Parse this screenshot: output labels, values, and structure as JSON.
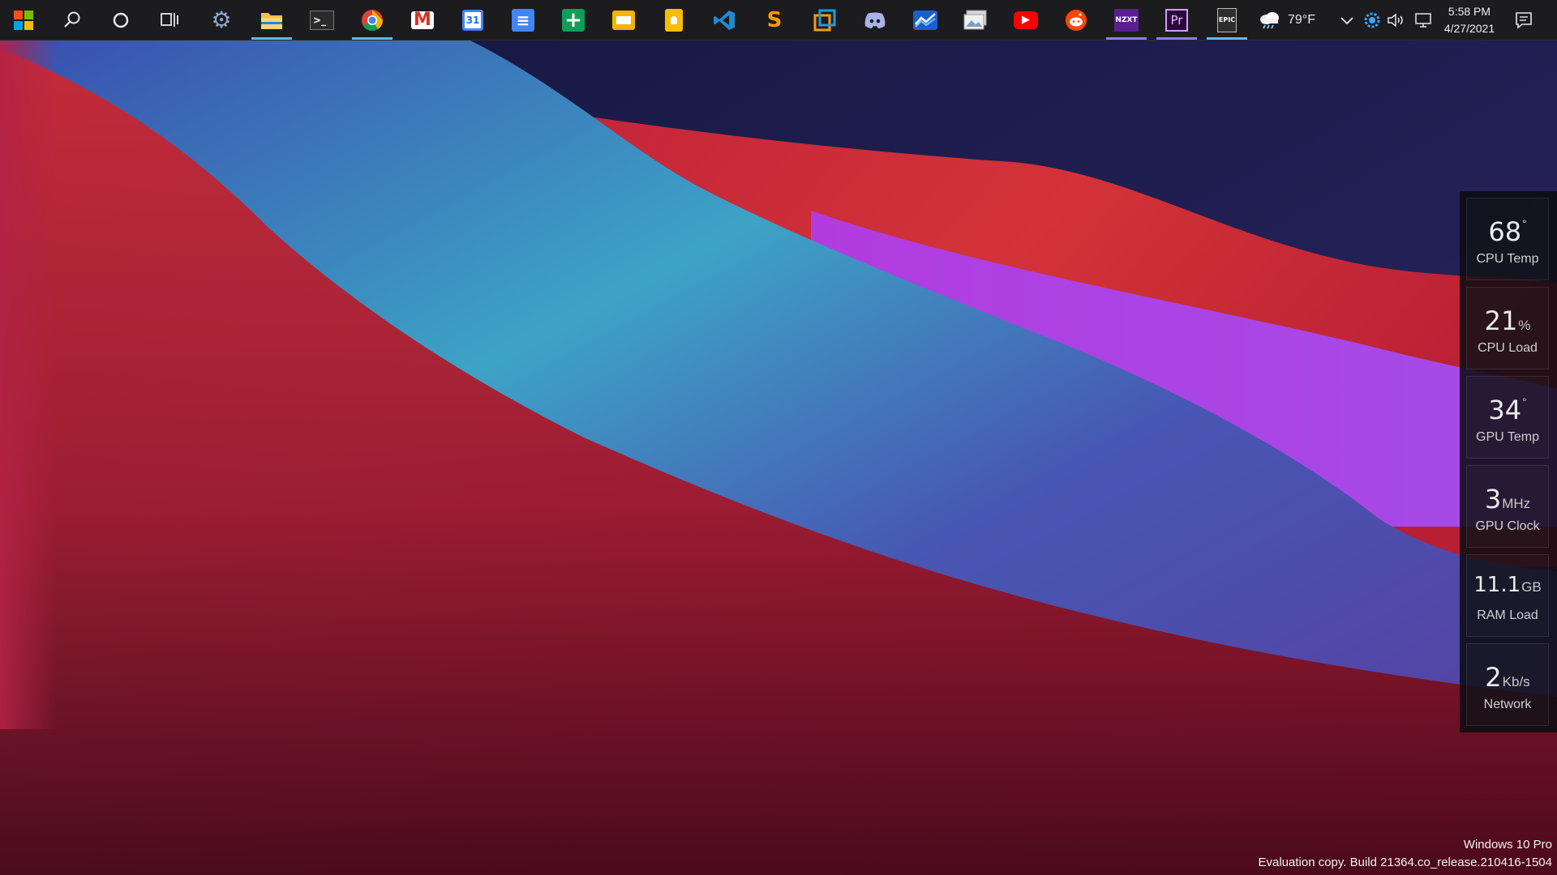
{
  "taskbar": {
    "apps": [
      {
        "name": "settings",
        "label": "⚙"
      },
      {
        "name": "file-explorer",
        "label": ""
      },
      {
        "name": "terminal",
        "label": ">_"
      },
      {
        "name": "chrome",
        "label": ""
      },
      {
        "name": "gmail",
        "label": "M"
      },
      {
        "name": "google-calendar",
        "label": "31"
      },
      {
        "name": "google-docs",
        "label": "≡"
      },
      {
        "name": "google-sheets",
        "label": "+"
      },
      {
        "name": "google-slides",
        "label": ""
      },
      {
        "name": "google-keep",
        "label": ""
      },
      {
        "name": "vscode",
        "label": ""
      },
      {
        "name": "sublime-text",
        "label": "S"
      },
      {
        "name": "virtualbox",
        "label": ""
      },
      {
        "name": "discord",
        "label": ""
      },
      {
        "name": "stocks-app",
        "label": ""
      },
      {
        "name": "photos-app",
        "label": ""
      },
      {
        "name": "youtube",
        "label": "▶"
      },
      {
        "name": "reddit",
        "label": ""
      },
      {
        "name": "nzxt-cam",
        "label": "NZXT"
      },
      {
        "name": "premiere-pro",
        "label": "Pr"
      },
      {
        "name": "epic-games",
        "label": "EPIC"
      }
    ],
    "colors": {
      "accent": "#60b8ff",
      "taskbar_bg": "#1c1c1f"
    }
  },
  "tray": {
    "weather_icon": "cloud-rain-icon",
    "temperature": "79°F",
    "time": "5:58 PM",
    "date": "4/27/2021"
  },
  "stats": [
    {
      "value": "68",
      "unit": "°",
      "label": "CPU Temp"
    },
    {
      "value": "21",
      "unit": "%",
      "label": "CPU Load"
    },
    {
      "value": "34",
      "unit": "°",
      "label": "GPU Temp"
    },
    {
      "value": "3",
      "unit": "MHz",
      "label": "GPU Clock"
    },
    {
      "value": "11.1",
      "unit": "GB",
      "label": "RAM Load"
    },
    {
      "value": "2",
      "unit": "Kb/s",
      "label": "Network"
    }
  ],
  "watermark": {
    "line1": "Windows 10 Pro",
    "line2": "Evaluation copy. Build 21364.co_release.210416-1504"
  }
}
